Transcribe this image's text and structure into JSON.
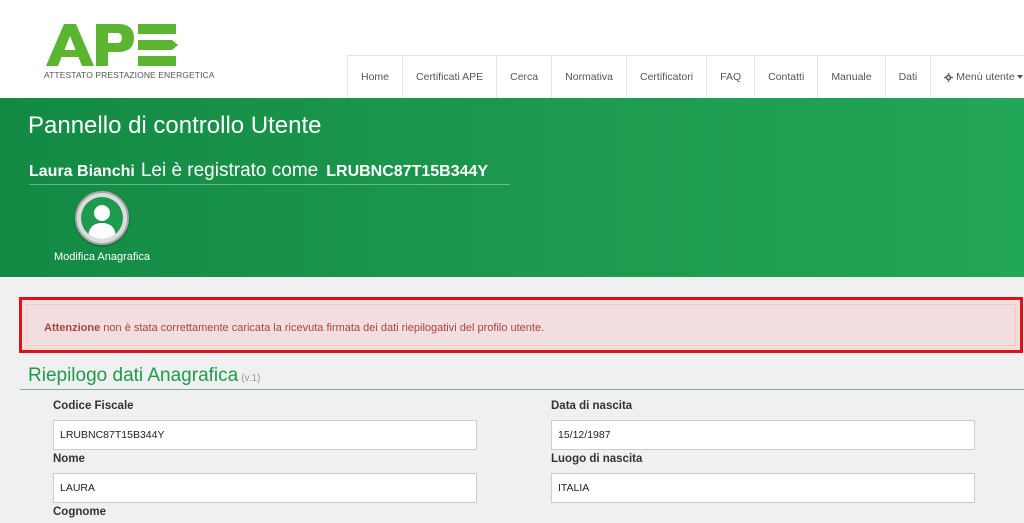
{
  "logo": {
    "text": "APE",
    "subtitle": "ATTESTATO PRESTAZIONE ENERGETICA",
    "brand_color": "#5cb531"
  },
  "nav": {
    "items": [
      "Home",
      "Certificati APE",
      "Cerca",
      "Normativa",
      "Certificatori",
      "FAQ",
      "Contatti",
      "Manuale",
      "Dati"
    ],
    "user_menu": "Menù utente",
    "user_menu_icon": "gear-icon"
  },
  "banner": {
    "title": "Pannello di controllo Utente",
    "user_name": "Laura Bianchi",
    "registered_as": "Lei è registrato come",
    "user_code": "LRUBNC87T15B344Y",
    "edit_label": "Modifica Anagrafica",
    "color": "#1d9a4f"
  },
  "alert": {
    "strong": "Attenzione",
    "message": "non è stata correttamente caricata la ricevuta firmata dei dati riepilogativi del profilo utente.",
    "text_color": "#a94442",
    "highlight_color": "#e0101a"
  },
  "section": {
    "title": "Riepilogo dati Anagrafica",
    "version": "(v.1)",
    "fields": {
      "codice_fiscale": {
        "label": "Codice Fiscale",
        "value": "LRUBNC87T15B344Y"
      },
      "data_nascita": {
        "label": "Data di nascita",
        "value": "15/12/1987"
      },
      "nome": {
        "label": "Nome",
        "value": "LAURA"
      },
      "luogo_nascita": {
        "label": "Luogo di nascita",
        "value": "ITALIA"
      },
      "cognome": {
        "label": "Cognome"
      }
    }
  }
}
